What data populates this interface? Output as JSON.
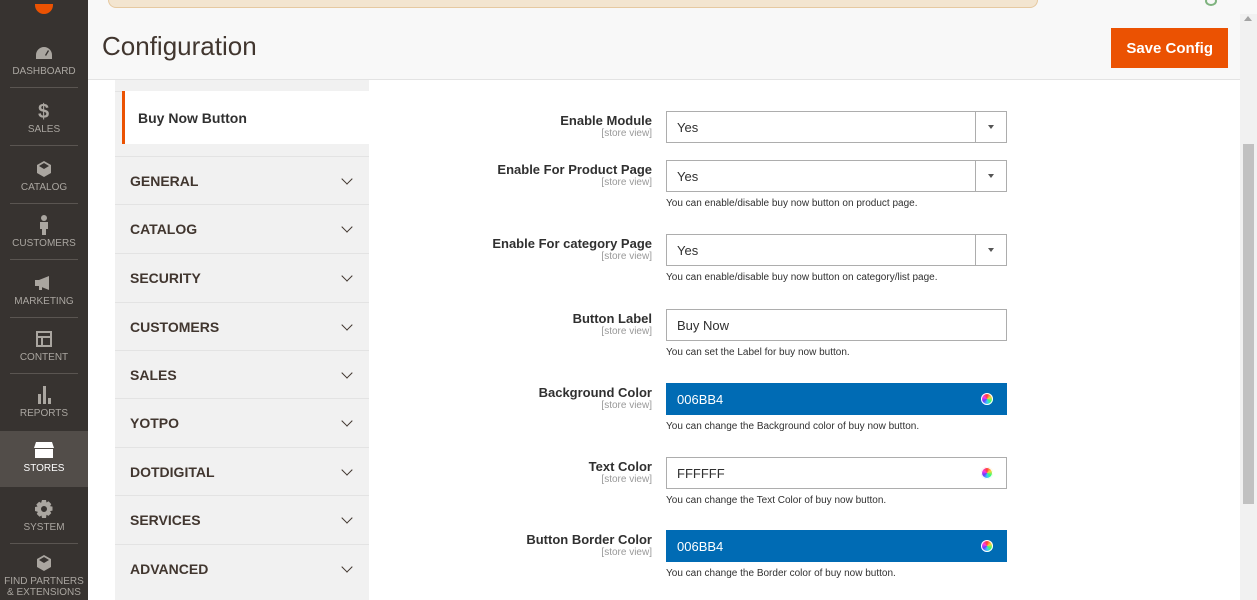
{
  "menu": {
    "items": [
      {
        "label": "Dashboard",
        "icon": "dashboard-icon"
      },
      {
        "label": "Sales",
        "icon": "dollar-icon"
      },
      {
        "label": "Catalog",
        "icon": "cube-icon"
      },
      {
        "label": "Customers",
        "icon": "person-icon"
      },
      {
        "label": "Marketing",
        "icon": "megaphone-icon"
      },
      {
        "label": "Content",
        "icon": "layout-icon"
      },
      {
        "label": "Reports",
        "icon": "bar-chart-icon"
      },
      {
        "label": "Stores",
        "icon": "store-icon"
      },
      {
        "label": "System",
        "icon": "gear-icon"
      },
      {
        "label": "Find Partners & Extensions",
        "icon": "box-icon"
      }
    ],
    "active": "Stores"
  },
  "header": {
    "title": "Configuration",
    "save_label": "Save Config"
  },
  "sidebar": {
    "subsection": "Buy Now Button",
    "sections": [
      "GENERAL",
      "CATALOG",
      "SECURITY",
      "CUSTOMERS",
      "SALES",
      "YOTPO",
      "DOTDIGITAL",
      "SERVICES",
      "ADVANCED"
    ]
  },
  "form": {
    "scope": "[store view]",
    "enable_module": {
      "label": "Enable Module",
      "value": "Yes"
    },
    "enable_product": {
      "label": "Enable For Product Page",
      "value": "Yes",
      "note": "You can enable/disable buy now button on product page."
    },
    "enable_category": {
      "label": "Enable For category Page",
      "value": "Yes",
      "note": "You can enable/disable buy now button on category/list page."
    },
    "button_label": {
      "label": "Button Label",
      "value": "Buy Now",
      "note": "You can set the Label for buy now button."
    },
    "bg_color": {
      "label": "Background Color",
      "value": "006BB4",
      "note": "You can change the Background color of buy now button."
    },
    "text_color": {
      "label": "Text Color",
      "value": "FFFFFF",
      "note": "You can change the Text Color of buy now button."
    },
    "border_color": {
      "label": "Button Border Color",
      "value": "006BB4",
      "note": "You can change the Border color of buy now button."
    }
  },
  "colors": {
    "accent": "#eb5202",
    "menu_bg": "#373330",
    "swatch": "#006bb4"
  }
}
